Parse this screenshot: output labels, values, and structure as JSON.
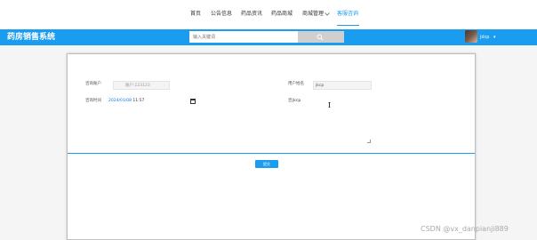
{
  "nav": {
    "items": [
      "首页",
      "公告信息",
      "药品资讯",
      "药品商城",
      "商城管理",
      "客服咨询"
    ],
    "active_index": 5
  },
  "header": {
    "brand": "药房销售系统",
    "search_placeholder": "输入关键词",
    "username": "jdcp",
    "caret": "▾"
  },
  "form": {
    "account_label": "咨询账户",
    "account_value": "账户:123123",
    "username_label": "用户姓名",
    "username_value": "jkcp",
    "time_label": "咨询时间",
    "date_value": "2024/01/08",
    "time_value": " 11:57",
    "content_label": "咨询内容",
    "content_value": "jkcp",
    "submit_label": "提交"
  },
  "watermark": "CSDN @vx_danpianji889",
  "colors": {
    "accent": "#1a9cf0",
    "header_bg": "#1a9cf0",
    "search_button": "#cfcfcf"
  }
}
